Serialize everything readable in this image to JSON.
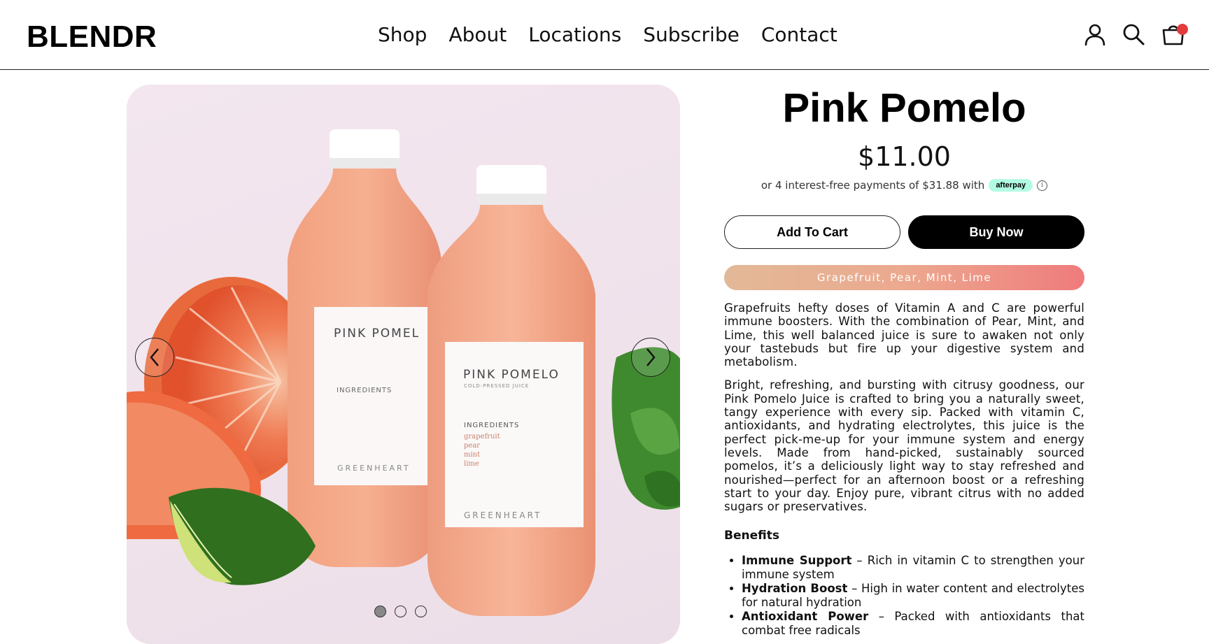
{
  "header": {
    "logo": "BLENDR",
    "nav": [
      "Shop",
      "About",
      "Locations",
      "Subscribe",
      "Contact"
    ],
    "icons": [
      "user-icon",
      "search-icon",
      "cart-icon"
    ],
    "cart_badge_color": "#e53b3b"
  },
  "gallery": {
    "bottle_label_title_back": "PINK POMEL",
    "bottle_label_title_front": "PINK POMELO",
    "bottle_label_sub": "COLD-PRESSED JUICE",
    "bottle_label_ingredients": "INGREDIENTS",
    "bottle_label_items": [
      "grapefruit",
      "pear",
      "mint",
      "lime"
    ],
    "bottle_label_brand": "GREENHEART",
    "slides_total": 3,
    "active_slide": 1
  },
  "product": {
    "title": "Pink Pomelo",
    "price": "$11.00",
    "afterpay_text": "or 4 interest-free payments of $31.88 with",
    "afterpay_badge": "afterpay",
    "add_to_cart": "Add To Cart",
    "buy_now": "Buy Now",
    "flavors": "Grapefruit, Pear, Mint, Lime",
    "description": [
      "Grapefruits hefty doses of Vitamin A and C are powerful immune boosters. With the combination of Pear, Mint, and Lime, this well balanced juice is sure to awaken not only your tastebuds but fire up your digestive system and metabolism.",
      "Bright, refreshing, and bursting with citrusy goodness, our Pink Pomelo Juice is crafted to bring you a naturally sweet, tangy experience with every sip. Packed with vitamin C, antioxidants, and hydrating electrolytes, this juice is the perfect pick-me-up for your immune system and energy levels. Made from hand-picked, sustainably sourced pomelos, it’s a deliciously light way to stay refreshed and nourished—perfect for an afternoon boost or a refreshing start to your day. Enjoy pure, vibrant citrus with no added sugars or preservatives."
    ],
    "benefits_heading": "Benefits",
    "benefits": [
      {
        "name": "Immune Support",
        "text": " – Rich in vitamin C to strengthen your immune system"
      },
      {
        "name": "Hydration Boost",
        "text": " – High in water content and electrolytes for natural hydration"
      },
      {
        "name": "Antioxidant Power",
        "text": " – Packed with antioxidants that combat free radicals"
      }
    ]
  }
}
